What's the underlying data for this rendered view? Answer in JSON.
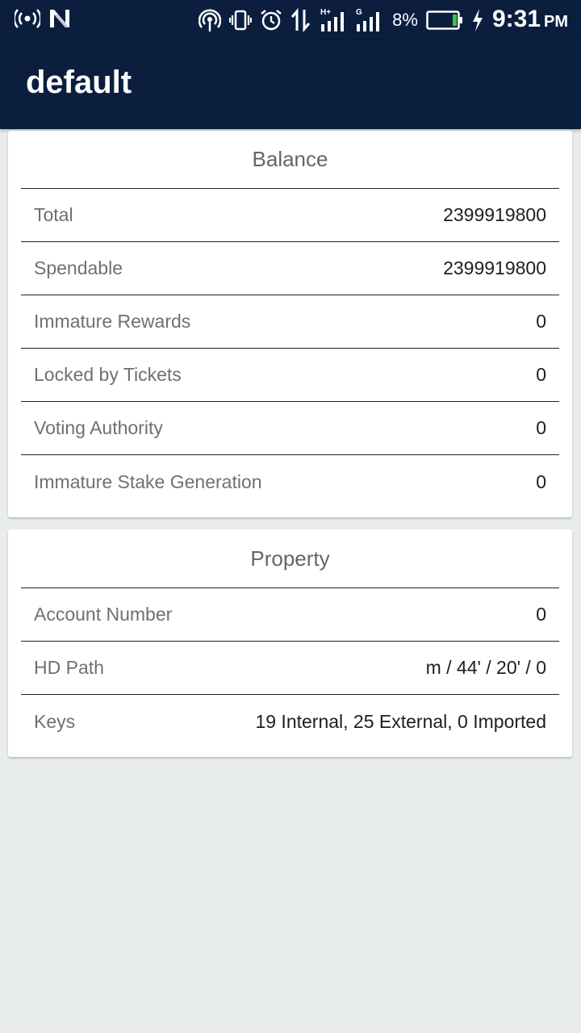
{
  "status_bar": {
    "battery_percent": "8%",
    "time": "9:31",
    "ampm": "PM",
    "network_labels": [
      "H+",
      "G"
    ],
    "icons": [
      "wifi-hotspot-icon",
      "n-brand-icon",
      "nfc-icon",
      "vibrate-icon",
      "alarm-icon",
      "data-transfer-icon",
      "signal-strength-icon",
      "battery-icon",
      "charging-icon"
    ],
    "colors": {
      "battery_level": "#3cc43c"
    }
  },
  "app_bar": {
    "title": "default",
    "background": "#0b1e3e"
  },
  "balance": {
    "header": "Balance",
    "rows": [
      {
        "label": "Total",
        "value": "2399919800"
      },
      {
        "label": "Spendable",
        "value": "2399919800"
      },
      {
        "label": "Immature Rewards",
        "value": "0"
      },
      {
        "label": "Locked by Tickets",
        "value": "0"
      },
      {
        "label": "Voting Authority",
        "value": "0"
      },
      {
        "label": "Immature Stake Generation",
        "value": "0"
      }
    ]
  },
  "property": {
    "header": "Property",
    "rows": [
      {
        "label": "Account Number",
        "value": "0"
      },
      {
        "label": "HD Path",
        "value": "m / 44' / 20' / 0"
      },
      {
        "label": "Keys",
        "value": "19 Internal, 25 External, 0 Imported"
      }
    ]
  }
}
